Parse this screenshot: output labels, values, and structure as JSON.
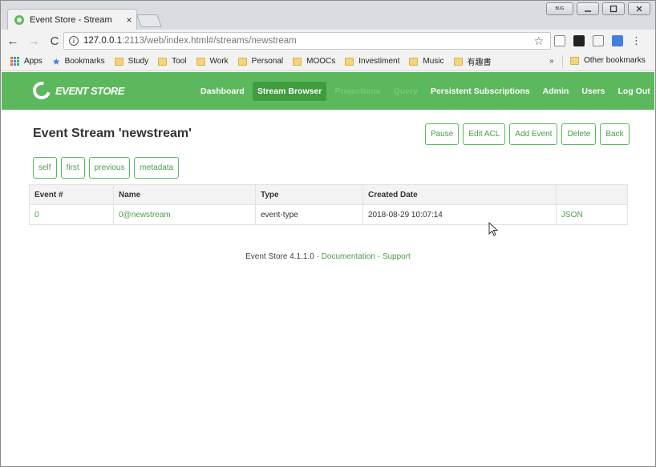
{
  "browser": {
    "tab_title": "Event Store - Stream",
    "tab_close": "×",
    "window_badge": "ᴮᵁᴳ",
    "url_host": "127.0.0.1",
    "url_rest": ":2113/web/index.html#/streams/newstream",
    "info_glyph": "i",
    "back_glyph": "←",
    "forward_glyph": "→",
    "reload_glyph": "C",
    "star_glyph": "☆",
    "menu_glyph": "⋮"
  },
  "bookmarks": {
    "apps": "Apps",
    "items": [
      "Bookmarks",
      "Study",
      "Tool",
      "Work",
      "Personal",
      "MOOCs",
      "Investiment",
      "Music",
      "有趣書"
    ],
    "more": "»",
    "other": "Other bookmarks"
  },
  "app": {
    "logo_text": "EVENT STORE",
    "nav": [
      "Dashboard",
      "Stream Browser",
      "Projections",
      "Query",
      "Persistent Subscriptions",
      "Admin",
      "Users",
      "Log Out"
    ],
    "title": "Event Stream 'newstream'",
    "actions": [
      "Pause",
      "Edit ACL",
      "Add Event",
      "Delete",
      "Back"
    ],
    "links": [
      "self",
      "first",
      "previous",
      "metadata"
    ],
    "table": {
      "headers": [
        "Event #",
        "Name",
        "Type",
        "Created Date",
        ""
      ],
      "rows": [
        {
          "number": "0",
          "name": "0@newstream",
          "type": "event-type",
          "created": "2018-08-29 10:07:14",
          "format": "JSON"
        }
      ]
    },
    "footer": {
      "version": "Event Store 4.1.1.0",
      "sep": " · ",
      "docs": "Documentation",
      "support": "Support"
    }
  },
  "colors": {
    "accent": "#5cb85c",
    "accent_dark": "#3f9d3f"
  }
}
